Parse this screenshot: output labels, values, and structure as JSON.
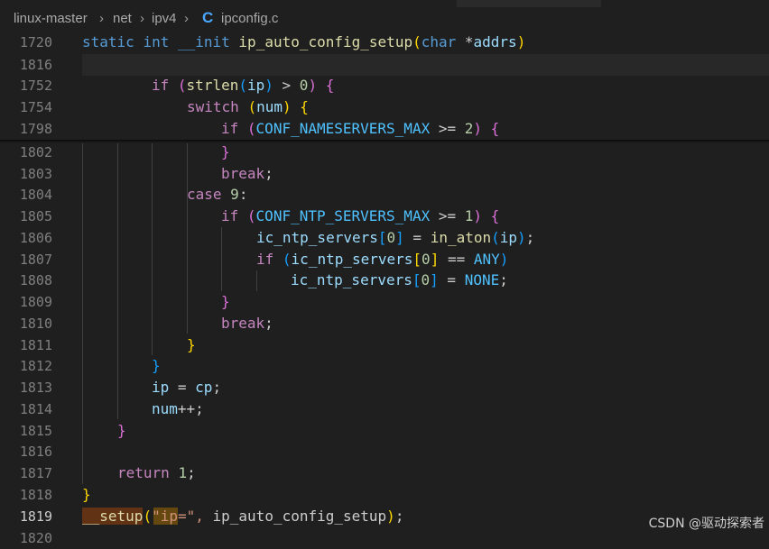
{
  "breadcrumb": {
    "parts": [
      "linux-master",
      "net",
      "ipv4"
    ],
    "file_icon": "C",
    "file": "ipconfig.c"
  },
  "sticky": [
    {
      "ln": "1720",
      "code": "static int __init ip_auto_config_setup(char *addrs)"
    },
    {
      "ln": "1816",
      "code": ""
    },
    {
      "ln": "1752",
      "code": "if (strlen(ip) > 0) {"
    },
    {
      "ln": "1754",
      "code": "switch (num) {"
    },
    {
      "ln": "1798",
      "code": "if (CONF_NAMESERVERS_MAX >= 2) {"
    }
  ],
  "lines": [
    {
      "ln": "1802",
      "code": "}"
    },
    {
      "ln": "1803",
      "code": "break;"
    },
    {
      "ln": "1804",
      "code": "case 9:"
    },
    {
      "ln": "1805",
      "code": "if (CONF_NTP_SERVERS_MAX >= 1) {"
    },
    {
      "ln": "1806",
      "code": "ic_ntp_servers[0] = in_aton(ip);"
    },
    {
      "ln": "1807",
      "code": "if (ic_ntp_servers[0] == ANY)"
    },
    {
      "ln": "1808",
      "code": "ic_ntp_servers[0] = NONE;"
    },
    {
      "ln": "1809",
      "code": "}"
    },
    {
      "ln": "1810",
      "code": "break;"
    },
    {
      "ln": "1811",
      "code": "}"
    },
    {
      "ln": "1812",
      "code": "}"
    },
    {
      "ln": "1813",
      "code": "ip = cp;"
    },
    {
      "ln": "1814",
      "code": "num++;"
    },
    {
      "ln": "1815",
      "code": "}"
    },
    {
      "ln": "1816",
      "code": ""
    },
    {
      "ln": "1817",
      "code": "return 1;"
    },
    {
      "ln": "1818",
      "code": "}"
    },
    {
      "ln": "1819",
      "code": "__setup(\"ip=\", ip_auto_config_setup);"
    },
    {
      "ln": "1820",
      "code": ""
    }
  ],
  "watermark": "CSDN @驱动探索者"
}
